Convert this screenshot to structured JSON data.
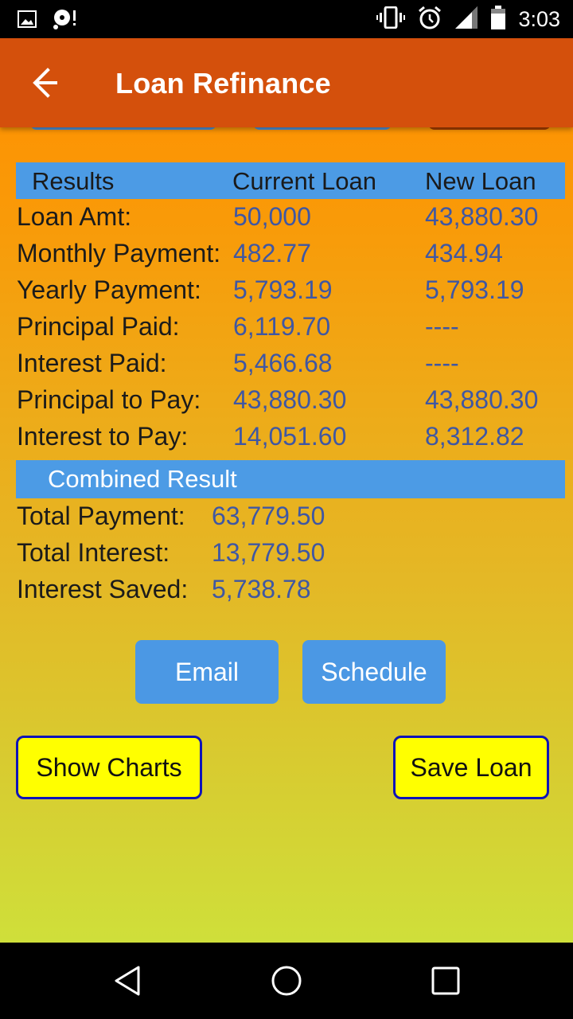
{
  "status_bar": {
    "time": "3:03",
    "left_icons": [
      "image-notification-icon",
      "media-alert-icon"
    ],
    "right_icons": [
      "vibrate-icon",
      "alarm-icon",
      "signal-icon",
      "battery-icon"
    ]
  },
  "app_bar": {
    "title": "Loan Refinance",
    "back_icon": "arrow-left-icon"
  },
  "results": {
    "headers": [
      "Results",
      "Current Loan",
      "New Loan"
    ],
    "rows": [
      {
        "label": "Loan Amt:",
        "current": "50,000",
        "new": "43,880.30"
      },
      {
        "label": "Monthly Payment:",
        "current": "482.77",
        "new": "434.94"
      },
      {
        "label": "Yearly Payment:",
        "current": "5,793.19",
        "new": "5,793.19"
      },
      {
        "label": "Principal Paid:",
        "current": "6,119.70",
        "new": "----"
      },
      {
        "label": "Interest Paid:",
        "current": "5,466.68",
        "new": "----"
      },
      {
        "label": "Principal to Pay:",
        "current": "43,880.30",
        "new": "43,880.30"
      },
      {
        "label": "Interest to Pay:",
        "current": "14,051.60",
        "new": "8,312.82"
      }
    ]
  },
  "combined": {
    "header": "Combined Result",
    "rows": [
      {
        "label": "Total Payment:",
        "value": "63,779.50"
      },
      {
        "label": "Total Interest:",
        "value": "13,779.50"
      },
      {
        "label": "Interest Saved:",
        "value": "5,738.78"
      }
    ]
  },
  "buttons": {
    "email": "Email",
    "schedule": "Schedule",
    "show_charts": "Show Charts",
    "save_loan": "Save Loan"
  },
  "colors": {
    "app_bar": "#d4500c",
    "header_band": "#4c9be5",
    "value_text": "#3f57a3",
    "yellow_button": "#ffff00",
    "yellow_button_border": "#0f14b8"
  },
  "nav_bar": {
    "icons": [
      "nav-back-icon",
      "nav-home-icon",
      "nav-recents-icon"
    ]
  }
}
